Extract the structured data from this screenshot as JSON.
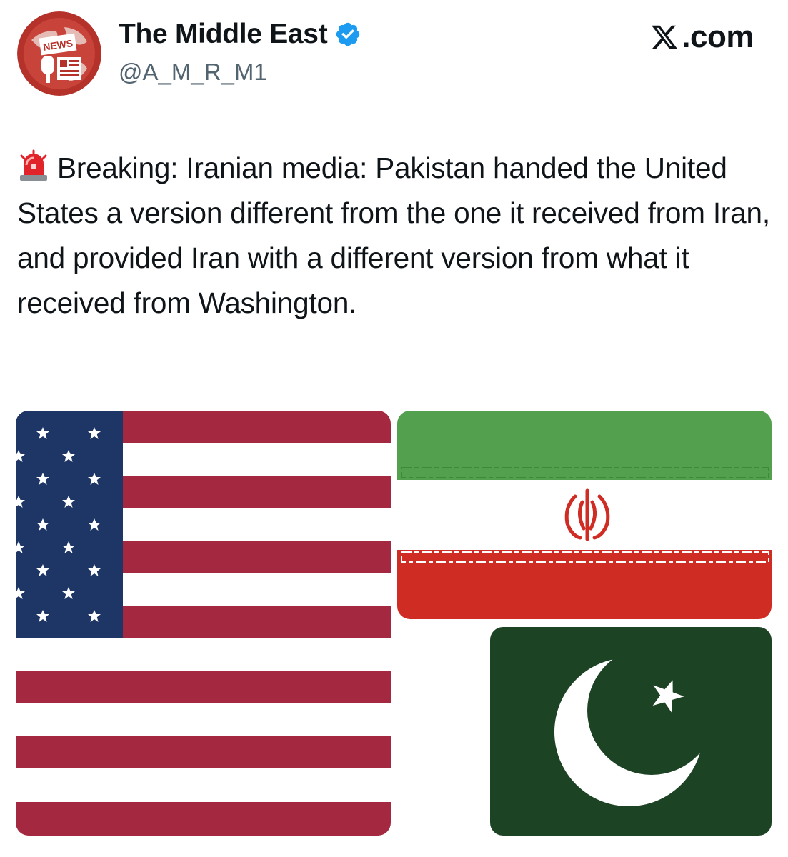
{
  "author": {
    "display_name": "The Middle East",
    "handle": "@A_M_R_M1",
    "verified": true,
    "avatar_badge": "NEWS",
    "avatar_icon": "globe-news-icon"
  },
  "platform": {
    "logo_text": ".com",
    "logo_icon": "x-logo-icon"
  },
  "tweet": {
    "emoji_icon": "police-siren-icon",
    "text": "Breaking: Iranian media: Pakistan handed the United States a version different from the one it received from Iran, and provided Iran with a different version from what it received from Washington."
  },
  "media": {
    "description_icons": [
      "us-flag-icon",
      "iran-flag-icon",
      "pakistan-flag-icon"
    ]
  },
  "colors": {
    "verified_blue": "#1d9bf0",
    "avatar_red": "#b5322a",
    "us_red": "#a4283f",
    "us_blue": "#1e3666",
    "iran_green": "#53a04e",
    "iran_red": "#cf2c24",
    "pakistan_green": "#1c4324"
  }
}
